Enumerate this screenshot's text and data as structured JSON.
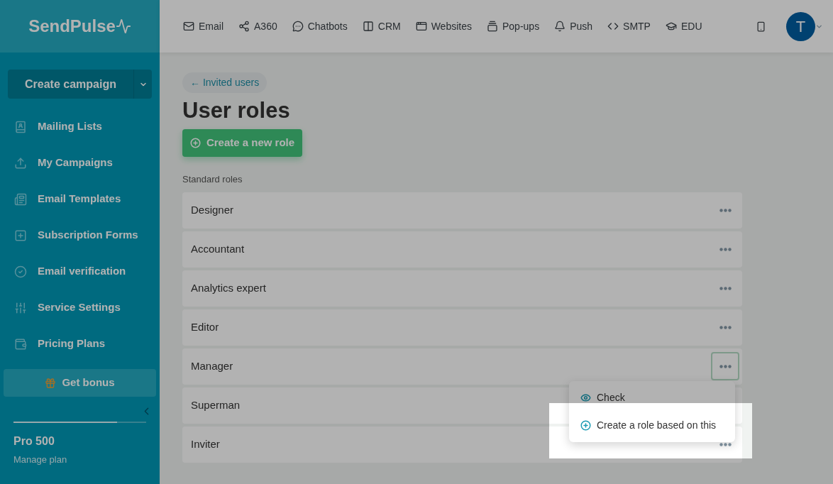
{
  "logo": "SendPulse",
  "top_nav": [
    {
      "label": "Email"
    },
    {
      "label": "A360"
    },
    {
      "label": "Chatbots"
    },
    {
      "label": "CRM"
    },
    {
      "label": "Websites"
    },
    {
      "label": "Pop-ups"
    },
    {
      "label": "Push"
    },
    {
      "label": "SMTP"
    },
    {
      "label": "EDU"
    }
  ],
  "avatar": "T",
  "sidebar": {
    "create_button": "Create campaign",
    "items": [
      {
        "label": "Mailing Lists"
      },
      {
        "label": "My Campaigns"
      },
      {
        "label": "Email Templates"
      },
      {
        "label": "Subscription Forms"
      },
      {
        "label": "Email verification"
      },
      {
        "label": "Service Settings"
      },
      {
        "label": "Pricing Plans"
      }
    ],
    "bonus_button": "Get bonus",
    "plan": {
      "level": 0.78,
      "name": "Pro 500",
      "link": "Manage plan"
    }
  },
  "breadcrumb": "← Invited users",
  "title": "User roles",
  "create_role_button": "Create a new role",
  "section_label": "Standard roles",
  "roles": [
    {
      "name": "Designer",
      "menu_open": false
    },
    {
      "name": "Accountant",
      "menu_open": false
    },
    {
      "name": "Analytics expert",
      "menu_open": false
    },
    {
      "name": "Editor",
      "menu_open": false
    },
    {
      "name": "Manager",
      "menu_open": true
    },
    {
      "name": "Superman",
      "menu_open": false
    },
    {
      "name": "Inviter",
      "menu_open": false
    }
  ],
  "role_menu": [
    {
      "label": "Check",
      "highlighted": false
    },
    {
      "label": "Create a role based on this",
      "highlighted": true
    }
  ]
}
